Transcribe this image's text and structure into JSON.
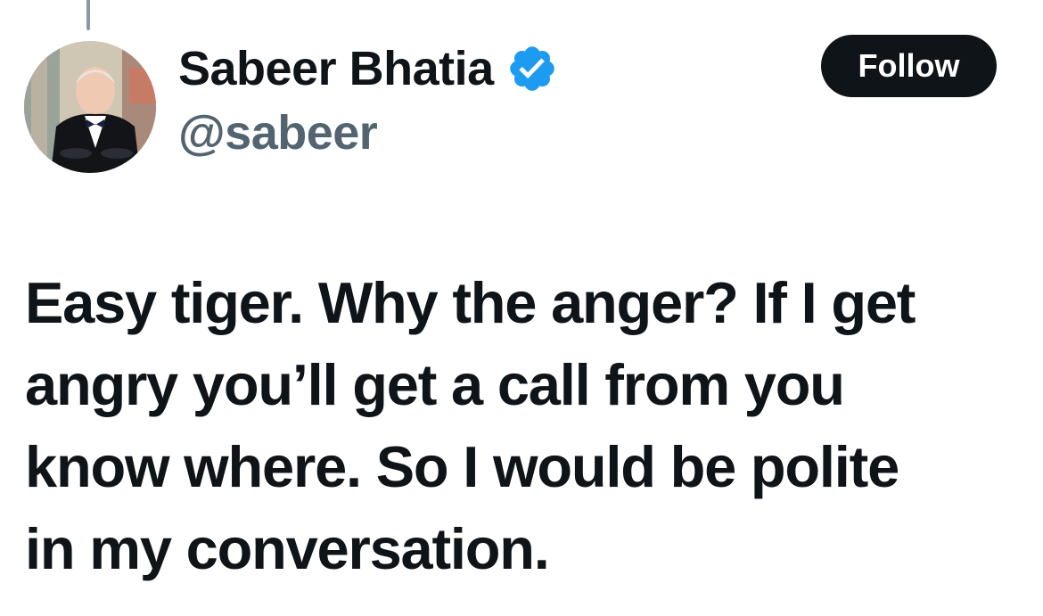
{
  "author": {
    "display_name": "Sabeer Bhatia",
    "handle": "@sabeer",
    "verified": true,
    "verified_color": "#1d9bf0"
  },
  "actions": {
    "follow_label": "Follow"
  },
  "tweet": {
    "lines": [
      "Easy tiger. Why the anger? If I get",
      "angry you’ll get a call from you",
      "know where. So I would be polite",
      "in my conversation."
    ]
  },
  "icons": {
    "verified": "verified-badge-icon"
  },
  "colors": {
    "text": "#0f1419",
    "secondary_text": "#536471",
    "button_bg": "#0f1419",
    "button_text": "#ffffff"
  }
}
